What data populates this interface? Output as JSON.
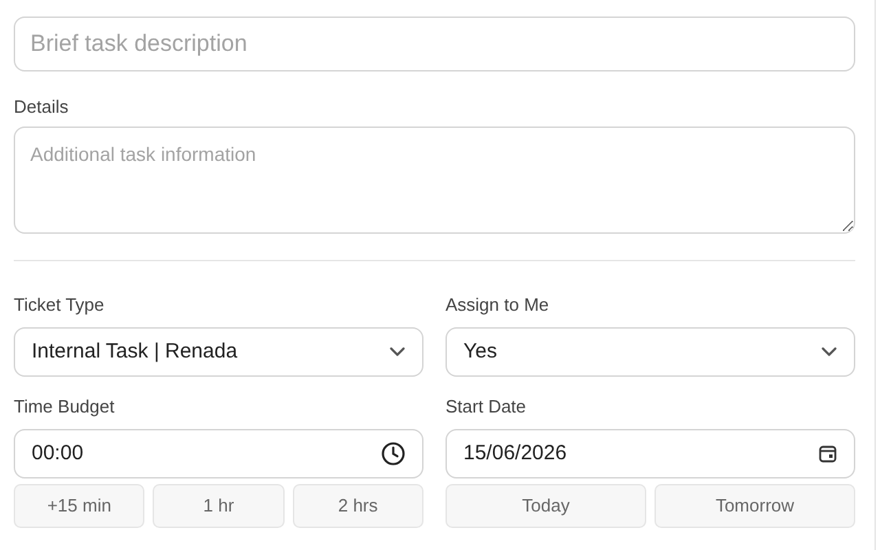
{
  "summary": {
    "placeholder": "Brief task description"
  },
  "details": {
    "label": "Details",
    "placeholder": "Additional task information"
  },
  "ticket_type": {
    "label": "Ticket Type",
    "value": "Internal Task | Renada"
  },
  "assign_to_me": {
    "label": "Assign to Me",
    "value": "Yes"
  },
  "time_budget": {
    "label": "Time Budget",
    "value": "00:00",
    "presets": [
      "+15 min",
      "1 hr",
      "2 hrs"
    ]
  },
  "start_date": {
    "label": "Start Date",
    "value": "15/06/2026",
    "presets": [
      "Today",
      "Tomorrow"
    ]
  }
}
